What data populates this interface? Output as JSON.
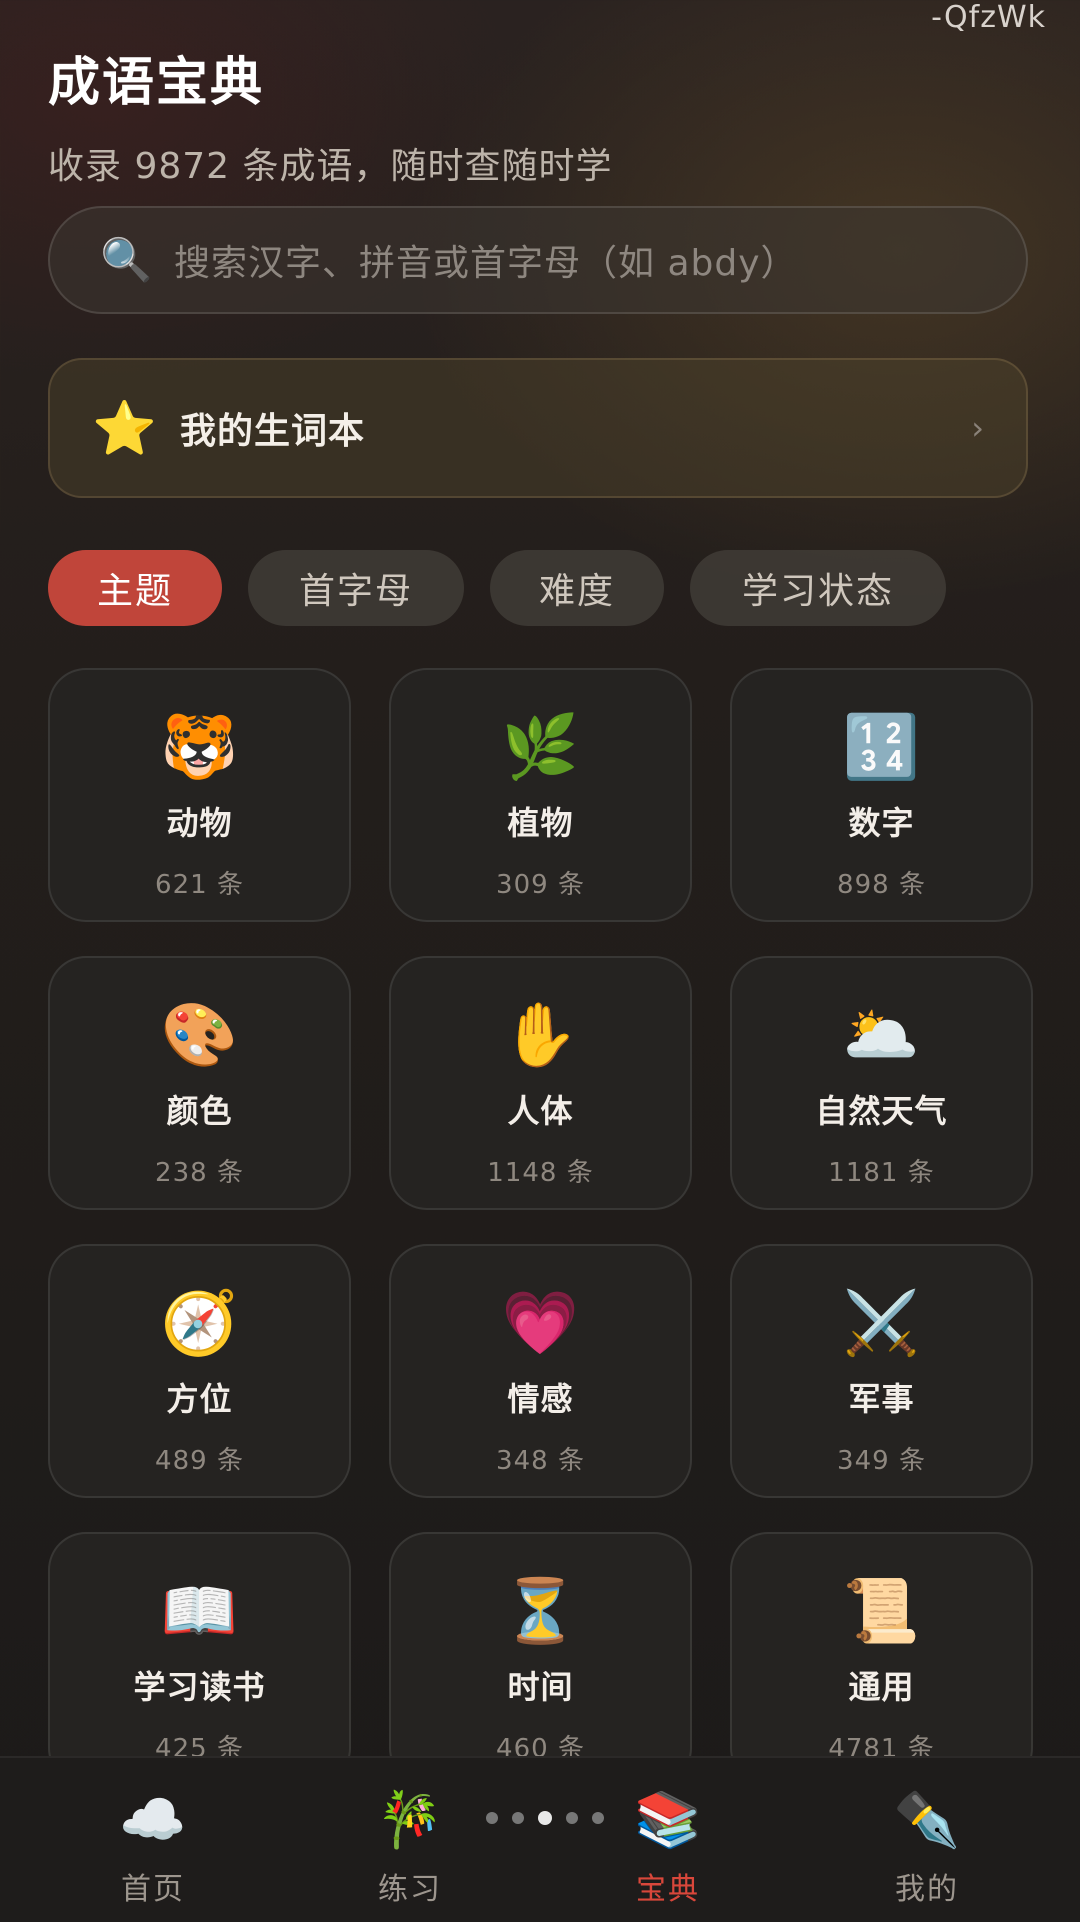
{
  "watermark": "-QfzWk",
  "header": {
    "title": "成语宝典",
    "subtitle": "收录 9872 条成语，随时查随时学"
  },
  "search": {
    "icon": "search-icon",
    "placeholder": "搜索汉字、拼音或首字母（如 abdy）"
  },
  "wordbook": {
    "icon": "star-icon",
    "label": "我的生词本",
    "chevron": "›"
  },
  "filters": {
    "active_index": 0,
    "tabs": [
      {
        "label": "主题"
      },
      {
        "label": "首字母"
      },
      {
        "label": "难度"
      },
      {
        "label": "学习状态"
      }
    ]
  },
  "categories": [
    {
      "icon": "🐯",
      "name": "动物",
      "count": "621 条"
    },
    {
      "icon": "🌿",
      "name": "植物",
      "count": "309 条"
    },
    {
      "icon": "🔢",
      "name": "数字",
      "count": "898 条"
    },
    {
      "icon": "🎨",
      "name": "颜色",
      "count": "238 条"
    },
    {
      "icon": "✋",
      "name": "人体",
      "count": "1148 条"
    },
    {
      "icon": "🌥️",
      "name": "自然天气",
      "count": "1181 条"
    },
    {
      "icon": "🧭",
      "name": "方位",
      "count": "489 条"
    },
    {
      "icon": "💗",
      "name": "情感",
      "count": "348 条"
    },
    {
      "icon": "⚔️",
      "name": "军事",
      "count": "349 条"
    },
    {
      "icon": "📖",
      "name": "学习读书",
      "count": "425 条"
    },
    {
      "icon": "⏳",
      "name": "时间",
      "count": "460 条"
    },
    {
      "icon": "📜",
      "name": "通用",
      "count": "4781 条"
    }
  ],
  "bottom_nav": {
    "active_index": 2,
    "items": [
      {
        "icon": "☁️",
        "label": "首页"
      },
      {
        "icon": "🎋",
        "label": "练习"
      },
      {
        "icon": "📚",
        "label": "宝典"
      },
      {
        "icon": "✒️",
        "label": "我的"
      }
    ],
    "page_dots": 5,
    "page_dot_active": 2
  },
  "colors": {
    "accent": "#c0453a",
    "active_nav_label": "#d9473b",
    "background": "#231e1b"
  }
}
